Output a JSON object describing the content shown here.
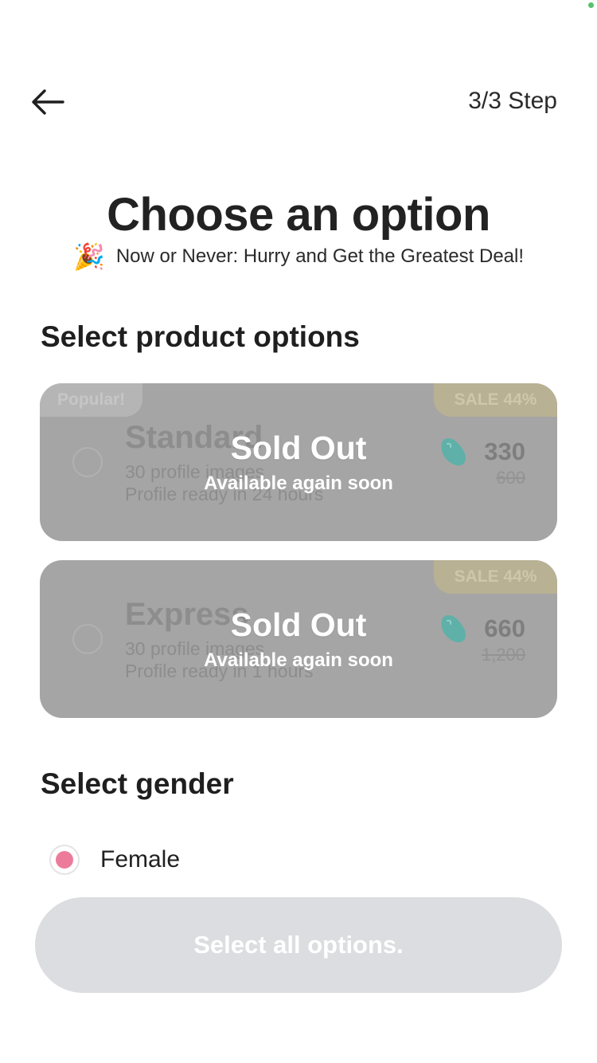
{
  "header": {
    "back_icon": "arrow-left-icon",
    "step": "3/3 Step"
  },
  "title": "Choose an option",
  "promo": {
    "icon": "party-popper-icon",
    "emoji": "🎉",
    "text": "Now or Never: Hurry and Get the Greatest Deal!"
  },
  "products": {
    "section_title": "Select product options",
    "items": [
      {
        "badge": "Popular!",
        "sale_badge": "SALE 44%",
        "name": "Standard",
        "line1": "30 profile images",
        "line2": "Profile ready in 24 hours",
        "price": "330",
        "old_price": "600",
        "sold_out_title": "Sold Out",
        "sold_out_subtitle": "Available again soon",
        "currency_icon": "jelly-bean-icon",
        "selected": false
      },
      {
        "sale_badge": "SALE 44%",
        "name": "Express",
        "line1": "30 profile images",
        "line2": "Profile ready in 1 hours",
        "price": "660",
        "old_price": "1,200",
        "sold_out_title": "Sold Out",
        "sold_out_subtitle": "Available again soon",
        "currency_icon": "jelly-bean-icon",
        "selected": false
      }
    ]
  },
  "gender": {
    "section_title": "Select gender",
    "options": [
      {
        "label": "Female",
        "selected": true
      }
    ]
  },
  "cta": {
    "label": "Select all options.",
    "enabled": false
  },
  "colors": {
    "accent_pink": "#ec7b9b",
    "card_overlay": "#a5a5a5",
    "cta_disabled": "#dcdde0",
    "bean_teal": "#5fb0a8"
  }
}
